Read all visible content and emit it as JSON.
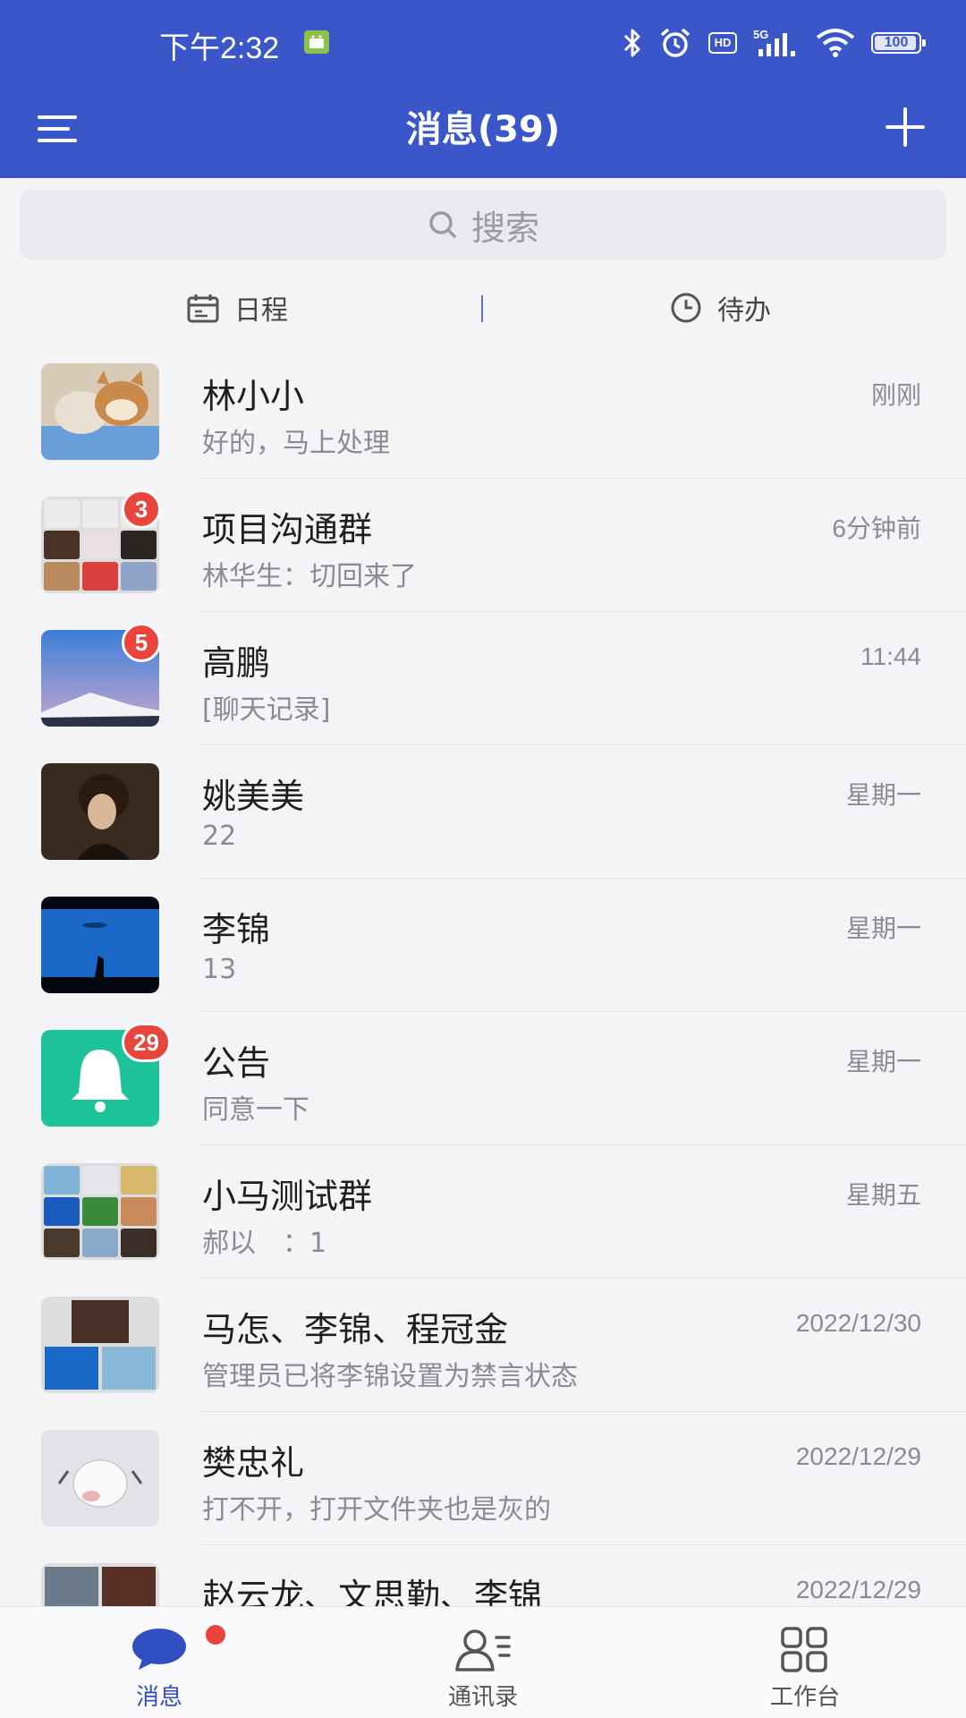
{
  "status": {
    "time": "下午2:32",
    "battery": "100"
  },
  "header": {
    "title": "消息(39)"
  },
  "search": {
    "placeholder": "搜索"
  },
  "quick": {
    "schedule": "日程",
    "todo": "待办"
  },
  "conversations": [
    {
      "name": "林小小",
      "preview": "好的，马上处理",
      "time": "刚刚",
      "badge": ""
    },
    {
      "name": "项目沟通群",
      "preview": "林华生：切回来了",
      "time": "6分钟前",
      "badge": "3"
    },
    {
      "name": "高鹏",
      "preview": "[聊天记录]",
      "time": "11:44",
      "badge": "5"
    },
    {
      "name": "姚美美",
      "preview": "22",
      "time": "星期一",
      "badge": ""
    },
    {
      "name": "李锦",
      "preview": "13",
      "time": "星期一",
      "badge": ""
    },
    {
      "name": "公告",
      "preview": "同意一下",
      "time": "星期一",
      "badge": "29"
    },
    {
      "name": "小马测试群",
      "preview": "郝以　：1",
      "time": "星期五",
      "badge": ""
    },
    {
      "name": "马怎、李锦、程冠金",
      "preview": "管理员已将李锦设置为禁言状态",
      "time": "2022/12/30",
      "badge": ""
    },
    {
      "name": "樊忠礼",
      "preview": "打不开，打开文件夹也是灰的",
      "time": "2022/12/29",
      "badge": ""
    },
    {
      "name": "赵云龙、文思勤、李锦",
      "preview": "",
      "time": "2022/12/29",
      "badge": ""
    }
  ],
  "tabs": {
    "messages": "消息",
    "contacts": "通讯录",
    "workbench": "工作台"
  },
  "colors": {
    "brand": "#3a56c8",
    "badge": "#e8453c",
    "notice": "#1fc39a"
  }
}
